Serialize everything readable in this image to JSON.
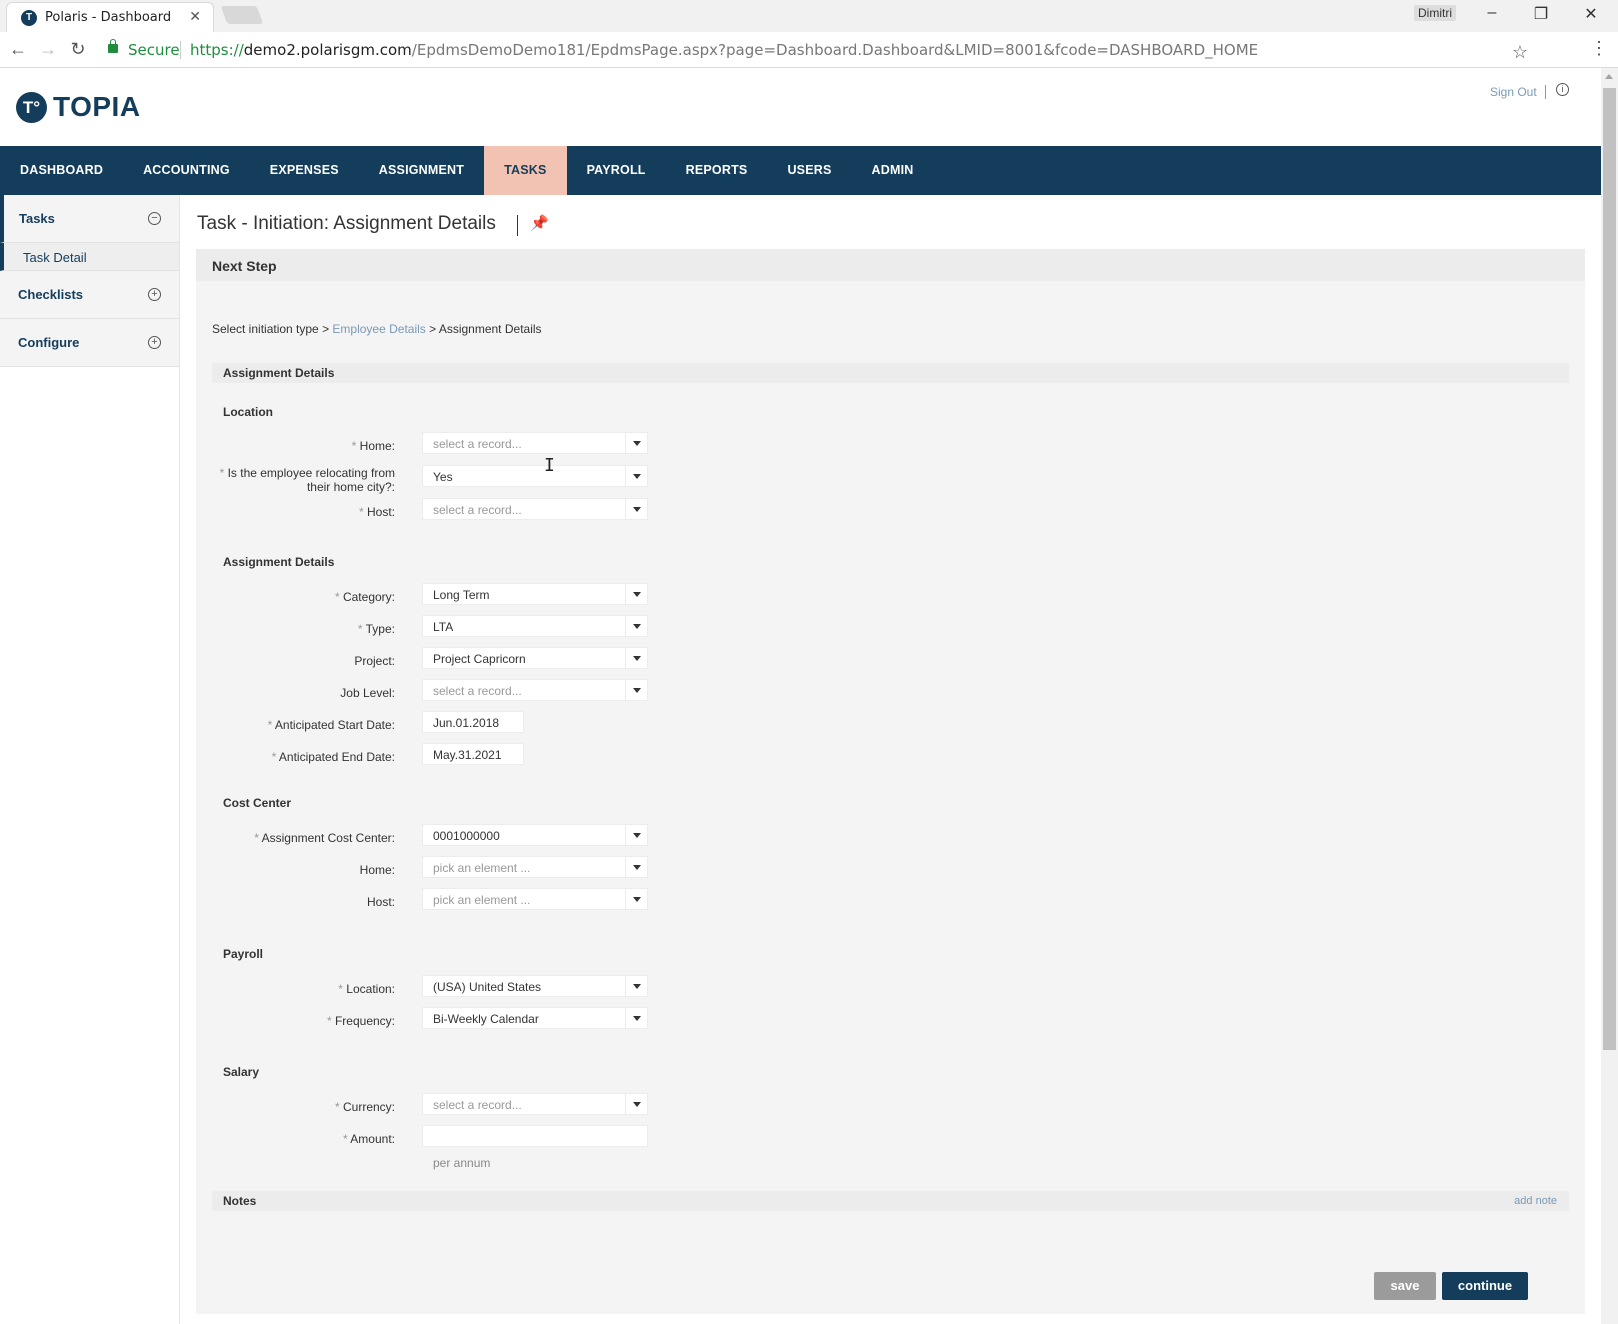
{
  "browser": {
    "tab_title": "Polaris - Dashboard",
    "user": "Dimitri",
    "secure_label": "Secure",
    "url_scheme": "https://",
    "url_host": "demo2.polarisgm.com",
    "url_path": "/EpdmsDemoDemo181/EpdmsPage.aspx?page=Dashboard.Dashboard&LMID=8001&fcode=DASHBOARD_HOME"
  },
  "header": {
    "logo_text": "TOPIA",
    "sign_out": "Sign Out"
  },
  "nav": {
    "items": [
      "DASHBOARD",
      "ACCOUNTING",
      "EXPENSES",
      "ASSIGNMENT",
      "TASKS",
      "PAYROLL",
      "REPORTS",
      "USERS",
      "ADMIN"
    ],
    "active": "TASKS"
  },
  "sidebar": {
    "tasks": "Tasks",
    "task_detail": "Task Detail",
    "checklists": "Checklists",
    "configure": "Configure"
  },
  "page": {
    "title": "Task - Initiation: Assignment Details",
    "panel_title": "Next Step",
    "breadcrumb": {
      "step1": "Select initiation type >",
      "step2": "Employee Details",
      "step3": "> Assignment Details"
    },
    "section_title": "Assignment Details"
  },
  "location": {
    "heading": "Location",
    "home_label": "Home:",
    "home_value": "select a record...",
    "relocating_label_1": "Is the employee relocating from",
    "relocating_label_2": "their home city?:",
    "relocating_value": "Yes",
    "host_label": "Host:",
    "host_value": "select a record..."
  },
  "assignment": {
    "heading": "Assignment Details",
    "category_label": "Category:",
    "category_value": "Long Term",
    "type_label": "Type:",
    "type_value": "LTA",
    "project_label": "Project:",
    "project_value": "Project Capricorn",
    "job_level_label": "Job Level:",
    "job_level_value": "select a record...",
    "start_label": "Anticipated Start Date:",
    "start_value": "Jun.01.2018",
    "end_label": "Anticipated End Date:",
    "end_value": "May.31.2021"
  },
  "cost_center": {
    "heading": "Cost Center",
    "assignment_label": "Assignment Cost Center:",
    "assignment_value": "0001000000",
    "home_label": "Home:",
    "home_value": "pick an element ...",
    "host_label": "Host:",
    "host_value": "pick an element ..."
  },
  "payroll": {
    "heading": "Payroll",
    "location_label": "Location:",
    "location_value": "(USA) United States",
    "frequency_label": "Frequency:",
    "frequency_value": "Bi-Weekly Calendar"
  },
  "salary": {
    "heading": "Salary",
    "currency_label": "Currency:",
    "currency_value": "select a record...",
    "amount_label": "Amount:",
    "amount_value": "",
    "per_annum": "per annum"
  },
  "notes": {
    "title": "Notes",
    "add_note": "add note"
  },
  "actions": {
    "save": "save",
    "continue": "continue"
  },
  "required_mark": "*"
}
